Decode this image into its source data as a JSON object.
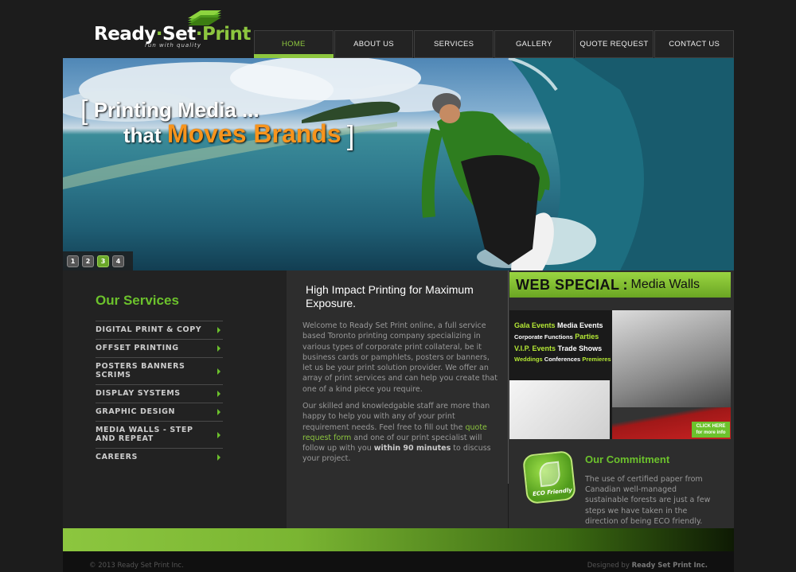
{
  "logo": {
    "part1": "Ready",
    "part2": "Set",
    "part3": "Print",
    "tagline": "run with quality"
  },
  "nav": [
    {
      "label": "HOME"
    },
    {
      "label": "ABOUT US"
    },
    {
      "label": "SERVICES"
    },
    {
      "label": "GALLERY"
    },
    {
      "label": "QUOTE REQUEST"
    },
    {
      "label": "CONTACT US"
    }
  ],
  "hero": {
    "line1": "Printing Media ...",
    "line2_a": "that",
    "line2_b": "Moves Brands",
    "slides": [
      "1",
      "2",
      "3",
      "4"
    ],
    "active_slide": "3"
  },
  "sidebar": {
    "title": "Our Services",
    "items": [
      {
        "label": "DIGITAL PRINT & COPY"
      },
      {
        "label": "OFFSET PRINTING"
      },
      {
        "label": "POSTERS BANNERS SCRIMS"
      },
      {
        "label": "DISPLAY SYSTEMS"
      },
      {
        "label": "GRAPHIC DESIGN"
      },
      {
        "label": "MEDIA WALLS - STEP AND REPEAT"
      },
      {
        "label": "CAREERS"
      }
    ]
  },
  "main": {
    "title": "High Impact Printing for Maximum Exposure.",
    "p1": "Welcome to Ready Set Print online, a full service based Toronto printing company specializing in various types of corporate print collateral, be it business cards or pamphlets, posters or banners, let us be your print solution provider.  We offer an array of print services and can help you create that one of a kind piece you require.",
    "p2_a": "Our skilled and knowledgable staff are more than happy to help you with any of your print requirement needs.  Feel free to fill out the ",
    "p2_link": "quote request form",
    "p2_b": " and one of our print specialist will follow up with you ",
    "p2_bold": "within 90 minutes",
    "p2_c": " to discuss your project."
  },
  "web_special": {
    "w1": "WEB SPECIAL",
    "w2": ":",
    "w3": "Media Walls",
    "l1_g": "Gala Events",
    "l1_w": "Media Events",
    "l2_w": "Corporate Functions",
    "l2_g": "Parties",
    "l3_g": "V.I.P. Events",
    "l3_w": "Trade Shows",
    "l4_a": "Weddings",
    "l4_b": "Conferences",
    "l4_c": "Premieres",
    "click": "CLICK HERE",
    "click_sub": "for more info"
  },
  "commitment": {
    "title": "Our Commitment",
    "text": "The use of certified paper from Canadian well-managed sustainable forests are just a few steps we have taken in the direction of being ECO friendly.",
    "eco_label": "ECO Friendly"
  },
  "footer": {
    "copyright": "© 2013 Ready Set Print Inc.",
    "designed_prefix": "Designed by",
    "designed_by": "Ready Set Print Inc."
  },
  "colors": {
    "accent": "#8dc63f",
    "orange": "#f7941d",
    "background": "#1c1c1c"
  }
}
